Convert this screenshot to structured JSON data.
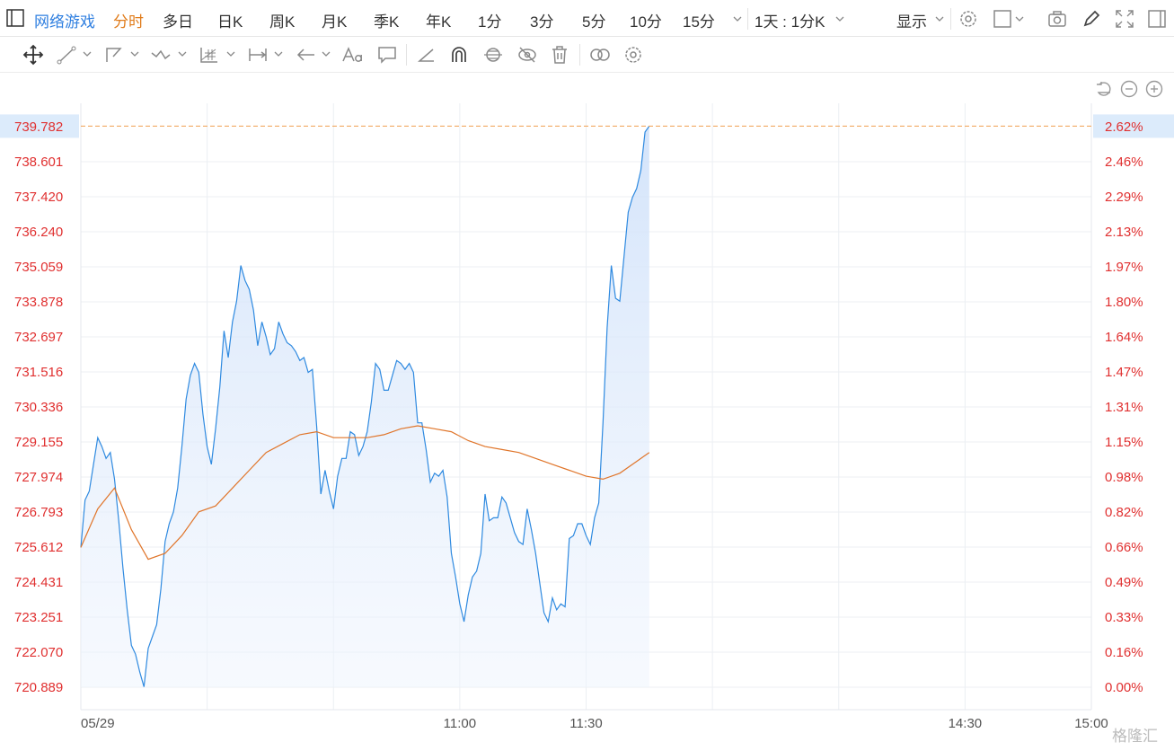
{
  "topbar": {
    "title": "网络游戏",
    "periods": [
      "分时",
      "多日",
      "日K",
      "周K",
      "月K",
      "季K",
      "年K",
      "1分",
      "3分",
      "5分",
      "10分",
      "15分"
    ],
    "active_period": "分时",
    "interval_select": "1天 : 1分K",
    "display_label": "显示"
  },
  "icons": {
    "top": [
      "sidebar-toggle-icon",
      "chevron-down-icon",
      "settings-icon",
      "checkbox-icon",
      "camera-icon",
      "pencil-icon",
      "fullscreen-icon",
      "panel-icon"
    ],
    "toolbar": [
      "move-icon",
      "line-tool-icon",
      "polyline-tool-icon",
      "wave-tool-icon",
      "grid-tool-icon",
      "measure-tool-icon",
      "arrow-tool-icon",
      "text-tool-icon",
      "comment-tool-icon",
      "angle-tool-icon",
      "magnet-icon",
      "lock-icon",
      "hide-icon",
      "trash-icon",
      "link-icon",
      "toolbar-settings-icon"
    ],
    "zoom": [
      "reset-icon",
      "zoom-out-icon",
      "zoom-in-icon"
    ]
  },
  "colors": {
    "price_line": "#2f8ae0",
    "area_fill": "#d6e6fb",
    "avg_line": "#e0752a",
    "axis_text": "#e03030",
    "grid": "#eceff3",
    "current_line": "#f0a050",
    "highlight": "#dcebfb"
  },
  "chart_data": {
    "type": "line",
    "y_left_ticks": [
      "739.782",
      "738.601",
      "737.420",
      "736.240",
      "735.059",
      "733.878",
      "732.697",
      "731.516",
      "730.336",
      "729.155",
      "727.974",
      "726.793",
      "725.612",
      "724.431",
      "723.251",
      "722.070",
      "720.889"
    ],
    "y_right_ticks": [
      "2.62%",
      "2.46%",
      "2.29%",
      "2.13%",
      "1.97%",
      "1.80%",
      "1.64%",
      "1.47%",
      "1.31%",
      "1.15%",
      "0.98%",
      "0.82%",
      "0.66%",
      "0.49%",
      "0.33%",
      "0.16%",
      "0.00%"
    ],
    "ylim": [
      720.889,
      739.782
    ],
    "x_ticks": [
      "05/29",
      "11:00",
      "11:30",
      "14:30",
      "15:00"
    ],
    "x_tick_minutes": [
      0,
      90,
      120,
      210,
      240
    ],
    "xlim": [
      0,
      240
    ],
    "current_value": "739.782",
    "current_pct": "2.62%",
    "series": [
      {
        "values": [
          [
            0,
            725.6
          ],
          [
            1,
            727.2
          ],
          [
            2,
            727.5
          ],
          [
            3,
            728.4
          ],
          [
            4,
            729.3
          ],
          [
            5,
            729.0
          ],
          [
            6,
            728.6
          ],
          [
            7,
            728.8
          ],
          [
            8,
            727.9
          ],
          [
            9,
            726.5
          ],
          [
            10,
            724.9
          ],
          [
            11,
            723.5
          ],
          [
            12,
            722.3
          ],
          [
            13,
            722.0
          ],
          [
            14,
            721.4
          ],
          [
            15,
            720.9
          ],
          [
            16,
            722.2
          ],
          [
            17,
            722.6
          ],
          [
            18,
            723.0
          ],
          [
            19,
            724.2
          ],
          [
            20,
            725.8
          ],
          [
            21,
            726.4
          ],
          [
            22,
            726.8
          ],
          [
            23,
            727.6
          ],
          [
            24,
            729.0
          ],
          [
            25,
            730.6
          ],
          [
            26,
            731.4
          ],
          [
            27,
            731.8
          ],
          [
            28,
            731.5
          ],
          [
            29,
            730.1
          ],
          [
            30,
            729.0
          ],
          [
            31,
            728.4
          ],
          [
            32,
            729.6
          ],
          [
            33,
            731.0
          ],
          [
            34,
            732.9
          ],
          [
            35,
            732.0
          ],
          [
            36,
            733.2
          ],
          [
            37,
            733.9
          ],
          [
            38,
            735.1
          ],
          [
            39,
            734.6
          ],
          [
            40,
            734.3
          ],
          [
            41,
            733.6
          ],
          [
            42,
            732.4
          ],
          [
            43,
            733.2
          ],
          [
            44,
            732.7
          ],
          [
            45,
            732.1
          ],
          [
            46,
            732.3
          ],
          [
            47,
            733.2
          ],
          [
            48,
            732.8
          ],
          [
            49,
            732.5
          ],
          [
            50,
            732.4
          ],
          [
            51,
            732.2
          ],
          [
            52,
            731.9
          ],
          [
            53,
            732.0
          ],
          [
            54,
            731.5
          ],
          [
            55,
            731.6
          ],
          [
            56,
            729.7
          ],
          [
            57,
            727.4
          ],
          [
            58,
            728.2
          ],
          [
            59,
            727.5
          ],
          [
            60,
            726.9
          ],
          [
            61,
            728.0
          ],
          [
            62,
            728.6
          ],
          [
            63,
            728.6
          ],
          [
            64,
            729.5
          ],
          [
            65,
            729.4
          ],
          [
            66,
            728.7
          ],
          [
            67,
            729.0
          ],
          [
            68,
            729.5
          ],
          [
            69,
            730.5
          ],
          [
            70,
            731.8
          ],
          [
            71,
            731.6
          ],
          [
            72,
            730.9
          ],
          [
            73,
            730.9
          ],
          [
            74,
            731.4
          ],
          [
            75,
            731.9
          ],
          [
            76,
            731.8
          ],
          [
            77,
            731.6
          ],
          [
            78,
            731.8
          ],
          [
            79,
            731.5
          ],
          [
            80,
            729.8
          ],
          [
            81,
            729.8
          ],
          [
            82,
            728.9
          ],
          [
            83,
            727.8
          ],
          [
            84,
            728.1
          ],
          [
            85,
            728.0
          ],
          [
            86,
            728.2
          ],
          [
            87,
            727.3
          ],
          [
            88,
            725.4
          ],
          [
            89,
            724.6
          ],
          [
            90,
            723.7
          ],
          [
            91,
            723.1
          ],
          [
            92,
            724.0
          ],
          [
            93,
            724.6
          ],
          [
            94,
            724.8
          ],
          [
            95,
            725.4
          ],
          [
            96,
            727.4
          ],
          [
            97,
            726.5
          ],
          [
            98,
            726.6
          ],
          [
            99,
            726.6
          ],
          [
            100,
            727.3
          ],
          [
            101,
            727.1
          ],
          [
            102,
            726.6
          ],
          [
            103,
            726.1
          ],
          [
            104,
            725.8
          ],
          [
            105,
            725.7
          ],
          [
            106,
            726.9
          ],
          [
            107,
            726.2
          ],
          [
            108,
            725.4
          ],
          [
            109,
            724.4
          ],
          [
            110,
            723.4
          ],
          [
            111,
            723.1
          ],
          [
            112,
            723.9
          ],
          [
            113,
            723.5
          ],
          [
            114,
            723.7
          ],
          [
            115,
            723.6
          ],
          [
            116,
            725.9
          ],
          [
            117,
            726.0
          ],
          [
            118,
            726.4
          ],
          [
            119,
            726.4
          ],
          [
            120,
            726.0
          ],
          [
            121,
            725.7
          ],
          [
            122,
            726.6
          ],
          [
            123,
            727.1
          ],
          [
            124,
            729.8
          ],
          [
            125,
            733.0
          ],
          [
            126,
            735.1
          ],
          [
            127,
            734.0
          ],
          [
            128,
            733.9
          ],
          [
            129,
            735.4
          ],
          [
            130,
            736.9
          ],
          [
            131,
            737.4
          ],
          [
            132,
            737.7
          ],
          [
            133,
            738.3
          ],
          [
            134,
            739.6
          ],
          [
            135,
            739.8
          ]
        ]
      },
      {
        "values": [
          [
            0,
            725.6
          ],
          [
            4,
            726.9
          ],
          [
            8,
            727.6
          ],
          [
            12,
            726.2
          ],
          [
            16,
            725.2
          ],
          [
            20,
            725.4
          ],
          [
            24,
            726.0
          ],
          [
            28,
            726.8
          ],
          [
            32,
            727.0
          ],
          [
            36,
            727.6
          ],
          [
            40,
            728.2
          ],
          [
            44,
            728.8
          ],
          [
            48,
            729.1
          ],
          [
            52,
            729.4
          ],
          [
            56,
            729.5
          ],
          [
            60,
            729.3
          ],
          [
            64,
            729.3
          ],
          [
            68,
            729.3
          ],
          [
            72,
            729.4
          ],
          [
            76,
            729.6
          ],
          [
            80,
            729.7
          ],
          [
            84,
            729.6
          ],
          [
            88,
            729.5
          ],
          [
            92,
            729.2
          ],
          [
            96,
            729.0
          ],
          [
            100,
            728.9
          ],
          [
            104,
            728.8
          ],
          [
            108,
            728.6
          ],
          [
            112,
            728.4
          ],
          [
            116,
            728.2
          ],
          [
            120,
            728.0
          ],
          [
            124,
            727.9
          ],
          [
            128,
            728.1
          ],
          [
            132,
            728.5
          ],
          [
            135,
            728.8
          ]
        ]
      }
    ]
  },
  "watermark": "格隆汇"
}
